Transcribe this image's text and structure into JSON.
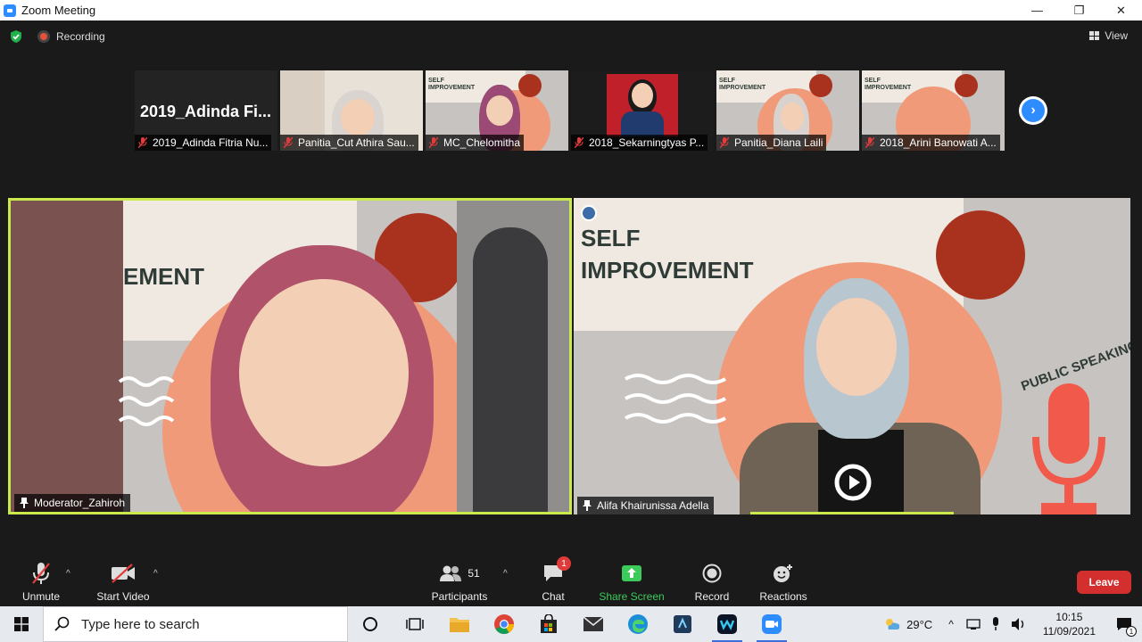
{
  "window": {
    "title": "Zoom Meeting",
    "minimize": "—",
    "maximize": "❐",
    "close": "✕"
  },
  "top_bar": {
    "recording_label": "Recording",
    "view_label": "View"
  },
  "gallery_strip": {
    "thumbnails": [
      {
        "name": "2019_Adinda Fitria Nu...",
        "display_text": "2019_Adinda  Fi..."
      },
      {
        "name": "Panitia_Cut Athira Sau..."
      },
      {
        "name": "MC_Chelomitha",
        "slide_title": "SELF\nIMPROVEMENT"
      },
      {
        "name": "2018_Sekarningtyas P..."
      },
      {
        "name": "Panitia_Diana Laili",
        "slide_title": "SELF\nIMPROVEMENT"
      },
      {
        "name": "2018_Arini Banowati A...",
        "slide_title": "SELF\nIMPROVEMENT"
      }
    ]
  },
  "main_tiles": {
    "left": {
      "name": "Moderator_Zahiroh",
      "slide_text": "EMENT"
    },
    "right": {
      "name": "Alifa Khairunissa Adella",
      "slide_title_1": "SELF",
      "slide_title_2": "IMPROVEMENT",
      "side_text": "PUBLIC SPEAKING"
    }
  },
  "toolbar": {
    "unmute": "Unmute",
    "start_video": "Start Video",
    "participants": "Participants",
    "participants_count": "51",
    "chat": "Chat",
    "chat_badge": "1",
    "share_screen": "Share Screen",
    "record": "Record",
    "reactions": "Reactions",
    "leave": "Leave"
  },
  "taskbar": {
    "search_placeholder": "Type here to search",
    "temperature": "29°C",
    "time": "10:15",
    "date": "11/09/2021",
    "notification_count": "1"
  },
  "colors": {
    "accent_blue": "#2d8cff",
    "active_speaker": "#c9ea4a",
    "share_green": "#3ccb5a",
    "leave_red": "#d32f2f"
  }
}
